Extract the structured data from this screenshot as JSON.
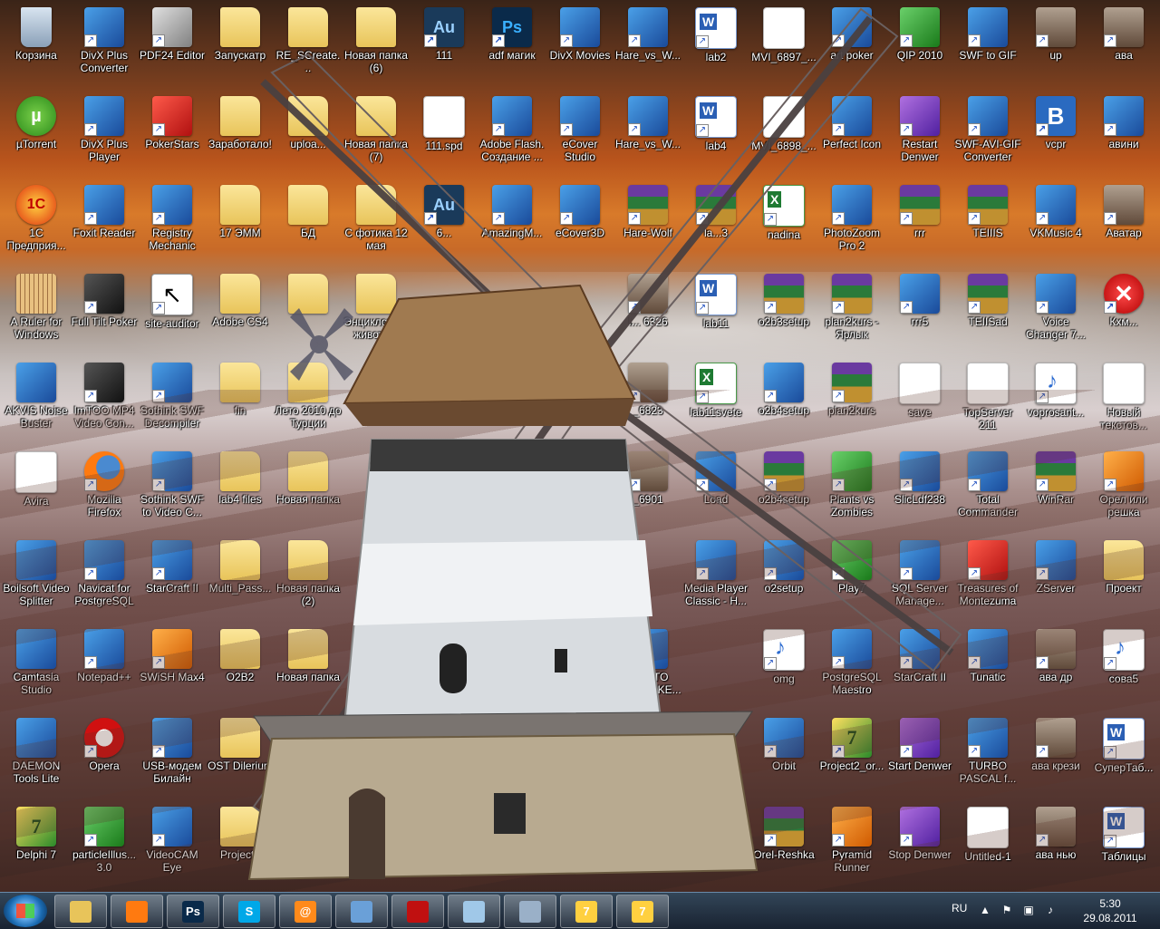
{
  "desktop": {
    "columns": [
      [
        "Корзина",
        "µTorrent",
        "1С Предприя...",
        "A Ruler for Windows",
        "AKVIS Noise Buster",
        "Avira",
        "Boilsoft Video Splitter",
        "Camtasia Studio",
        "DAEMON Tools Lite",
        "Delphi 7"
      ],
      [
        "DivX Plus Converter",
        "DivX Plus Player",
        "Foxit Reader",
        "Full Tilt Poker",
        "ImTOO MP4 Video Con...",
        "Mozilla Firefox",
        "Navicat for PostgreSQL",
        "Notepad++",
        "Opera",
        "particleIllus... 3.0"
      ],
      [
        "PDF24 Editor",
        "PokerStars",
        "Registry Mechanic",
        "site-auditor",
        "Sothink SWF Decompiler",
        "Sothink SWF to Video C...",
        "StarCraft II",
        "SWiSH Max4",
        "USB-модем Билайн",
        "VideoCAM Eye"
      ],
      [
        "Запускатр",
        "Заработало!",
        "17 ЭММ",
        "Adobe CS4",
        "fin",
        "lab4 files",
        "Multi_Pass...",
        "O2B2",
        "OST Dilerium",
        "Project1"
      ],
      [
        "RE_SCreate...",
        "uploa...",
        "БД",
        "",
        "Лето 2010 до Турции",
        "Новая папка",
        "Новая папка (2)",
        "Новая папка",
        "",
        ""
      ],
      [
        "Новая папка (6)",
        "Новая папка (7)",
        "С фотика 12 мая",
        "Энциклопе... животн...",
        "",
        "",
        "",
        "",
        "",
        ""
      ],
      [
        "111",
        "111.spd",
        "6...",
        "",
        "",
        "",
        "",
        "",
        "",
        ""
      ],
      [
        "adf магик",
        "Adobe Flash. Создание ...",
        "AmazingM...",
        "",
        "",
        "",
        "",
        "",
        "",
        ""
      ],
      [
        "DivX Movies",
        "eCover Studio",
        "eCover3D",
        "",
        "",
        "",
        "",
        "",
        "",
        ""
      ],
      [
        "Hare_vs_W...",
        "Hare_vs_W...",
        "Hare-Wolf",
        "I... 6326",
        "_6823",
        "_6901",
        "",
        "MIDI TO WAV MAKE...",
        "",
        ""
      ],
      [
        "lab2",
        "lab4",
        "la...3",
        "lab11",
        "lab11svete",
        "Load",
        "Media Player Classic - H...",
        "",
        "",
        ""
      ],
      [
        "MVI_6897_...",
        "MVI_6898_...",
        "nadina",
        "o2b3setup",
        "o2b4setup",
        "o2b4setup",
        "o2setup",
        "omg",
        "Orbit",
        "Orel-Reshka"
      ],
      [
        "art poker",
        "Perfect Icon",
        "PhotoZoom Pro 2",
        "plan2kurs - Ярлык",
        "plan2kurs",
        "Plants vs Zombies",
        "Play7",
        "PostgreSQL Maestro",
        "Project2_or...",
        "Pyramid Runner"
      ],
      [
        "QIP 2010",
        "Restart Denwer",
        "rrr",
        "rrr5",
        "save",
        "SlicLdf238",
        "SQL Server Manage...",
        "StarCraft II",
        "Start Denwer",
        "Stop Denwer"
      ],
      [
        "SWF to GIF",
        "SWF-AVI-GIF Converter",
        "TEIIIS",
        "TEIISad",
        "TopServer 211",
        "Total Commander",
        "Treasures of Montezuma",
        "Tunatic",
        "TURBO PASCAL f...",
        "Untitled-1"
      ],
      [
        "up",
        "vcpr",
        "VKMusic 4",
        "Voice Changer 7...",
        "voprosant...",
        "WinRar",
        "ZServer",
        "ава др",
        "ава крези",
        "ава нью"
      ],
      [
        "ава",
        "авини",
        "Аватар",
        "Кхм...",
        "Новый текстов...",
        "Орел или решка",
        "Проект",
        "сова5",
        "СуперТаб...",
        "Таблицы"
      ]
    ],
    "icon_types": [
      [
        "recycle-bin-icon",
        "utorrent-icon",
        "1c-icon",
        "ruler-icon",
        "akvis-icon",
        "document-icon",
        "scissors-icon",
        "camtasia-icon",
        "daemon-icon",
        "delphi-icon"
      ],
      [
        "divx-icon",
        "divx-icon",
        "foxit-icon",
        "fulltilt-icon",
        "imtoo-icon",
        "firefox-icon",
        "navicat-icon",
        "notepad-icon",
        "opera-icon",
        "hand-icon"
      ],
      [
        "pdf24-icon",
        "pokerstars-icon",
        "registry-icon",
        "cursor-icon",
        "sothink-icon",
        "sothink-icon",
        "starcraft-icon",
        "swish-icon",
        "modem-icon",
        "camera-icon"
      ],
      [
        "folder-icon",
        "folder-icon",
        "folder-icon",
        "folder-icon",
        "folder-icon",
        "folder-icon",
        "folder-icon",
        "folder-icon",
        "folder-icon",
        "folder-icon"
      ],
      [
        "folder-icon",
        "folder-icon",
        "folder-icon",
        "folder-icon",
        "folder-icon",
        "folder-icon",
        "folder-icon",
        "folder-icon",
        "",
        ""
      ],
      [
        "folder-icon",
        "folder-icon",
        "folder-icon",
        "folder-icon",
        "",
        "",
        "",
        "",
        "",
        ""
      ],
      [
        "audition-icon",
        "document-icon",
        "audition-icon",
        "",
        "",
        "",
        "",
        "",
        "",
        ""
      ],
      [
        "photoshop-icon",
        "flash-icon",
        "amazing-icon",
        "",
        "",
        "",
        "",
        "",
        "",
        ""
      ],
      [
        "divx-movies-icon",
        "ecover-icon",
        "ecover3d-icon",
        "",
        "",
        "",
        "",
        "",
        "",
        ""
      ],
      [
        "hare-icon",
        "hare-icon",
        "rar-icon",
        "photo-icon",
        "photo-icon",
        "photo-icon",
        "",
        "midi-icon",
        "",
        ""
      ],
      [
        "word-icon",
        "word-icon",
        "rar-icon",
        "word-icon",
        "excel-icon",
        "app-icon",
        "media-player-icon",
        "",
        "",
        ""
      ],
      [
        "document-icon",
        "document-icon",
        "excel-icon",
        "rar-icon",
        "setup-icon",
        "rar-icon",
        "setup-icon",
        "note-icon",
        "app-icon",
        "rar-icon"
      ],
      [
        "art-poker-icon",
        "perfect-icon",
        "photozoom-icon",
        "rar-icon",
        "rar-icon",
        "plants-icon",
        "play7-icon",
        "postgres-icon",
        "delphi-icon",
        "pyramid-icon"
      ],
      [
        "qip-icon",
        "denwer-icon",
        "rar-icon",
        "app-icon",
        "document-icon",
        "app-icon",
        "sqlserver-icon",
        "starcraft-icon",
        "denwer-icon",
        "denwer-icon"
      ],
      [
        "flash-swf-icon",
        "film-icon",
        "rar-icon",
        "rar-icon",
        "document-icon",
        "floppy-icon",
        "treasure-icon",
        "tunatic-icon",
        "app-icon",
        "document-icon"
      ],
      [
        "avatar-icon",
        "vcpr-icon",
        "vkmusic-icon",
        "voice-icon",
        "note-icon",
        "winrar-icon",
        "server-icon",
        "avatar-icon",
        "avatar-icon",
        "avatar-icon"
      ],
      [
        "avatar-icon",
        "speaker-icon",
        "avatar-icon",
        "close-icon",
        "document-icon",
        "coin-icon",
        "folder-icon",
        "note-icon",
        "word-icon",
        "word-icon"
      ]
    ]
  },
  "taskbar": {
    "buttons": [
      {
        "name": "explorer-task",
        "glyph": "",
        "color": "#e8c45a"
      },
      {
        "name": "firefox-task",
        "glyph": "",
        "color": "#ff7a10"
      },
      {
        "name": "photoshop-task",
        "glyph": "Ps",
        "color": "#0a2a4a"
      },
      {
        "name": "skype-task",
        "glyph": "S",
        "color": "#00a8e8"
      },
      {
        "name": "mail-task",
        "glyph": "@",
        "color": "#ff8a1a"
      },
      {
        "name": "paint-task",
        "glyph": "",
        "color": "#6aa0d8"
      },
      {
        "name": "acrobat-task",
        "glyph": "",
        "color": "#c01010"
      },
      {
        "name": "notebook-task",
        "glyph": "",
        "color": "#a0c8e8"
      },
      {
        "name": "calculator-task",
        "glyph": "",
        "color": "#9ab0c8"
      },
      {
        "name": "delphi-task",
        "glyph": "7",
        "color": "#ffd040"
      },
      {
        "name": "delphi2-task",
        "glyph": "7",
        "color": "#ffd040"
      }
    ],
    "tray": {
      "lang": "RU",
      "time": "5:30",
      "date": "29.08.2011"
    }
  }
}
